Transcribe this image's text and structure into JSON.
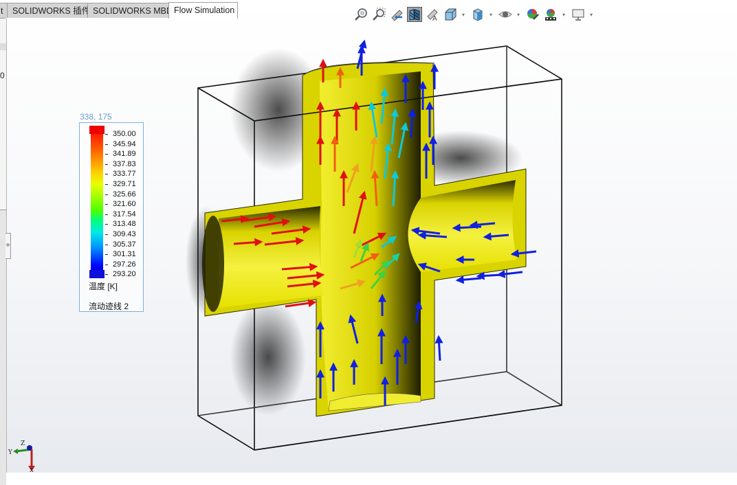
{
  "tabs": [
    {
      "label": "t",
      "active": false
    },
    {
      "label": "SOLIDWORKS 插件",
      "active": false
    },
    {
      "label": "SOLIDWORKS MBD",
      "active": false
    },
    {
      "label": "Flow Simulation",
      "active": true
    }
  ],
  "left_panel": {
    "value_text": "0"
  },
  "heads_up_toolbar": [
    {
      "name": "zoom-to-fit",
      "dropdown": false
    },
    {
      "name": "zoom-to-area",
      "dropdown": false
    },
    {
      "name": "previous-view",
      "dropdown": false
    },
    {
      "name": "section-view",
      "dropdown": false,
      "selected": true
    },
    {
      "name": "dynamic-annotation-views",
      "dropdown": false
    },
    {
      "name": "view-orientation",
      "dropdown": true
    },
    {
      "name": "display-style",
      "dropdown": true
    },
    {
      "name": "hide-show-items",
      "dropdown": true
    },
    {
      "name": "edit-appearance",
      "dropdown": false
    },
    {
      "name": "apply-scene",
      "dropdown": true
    },
    {
      "name": "view-settings",
      "dropdown": true
    }
  ],
  "legend": {
    "coords": "338, 175",
    "values": [
      "350.00",
      "345.94",
      "341.89",
      "337.83",
      "333.77",
      "329.71",
      "325.66",
      "321.60",
      "317.54",
      "313.48",
      "309.43",
      "305.37",
      "301.31",
      "297.26",
      "293.20"
    ],
    "unit": "温度 [K]",
    "plot_name": "流动迹线 2",
    "colors": {
      "max": "#ff0000",
      "mid": "#ffff00",
      "low": "#00ffff",
      "min": "#0000ff"
    }
  },
  "model": {
    "body_color": "#e6e000",
    "box_edge_color": "#111111",
    "hot_arrow_color": "#e01010",
    "cold_arrow_color": "#1020e0"
  },
  "triad": {
    "x_label": "X",
    "y_label": "Y",
    "z_label": "Z"
  }
}
